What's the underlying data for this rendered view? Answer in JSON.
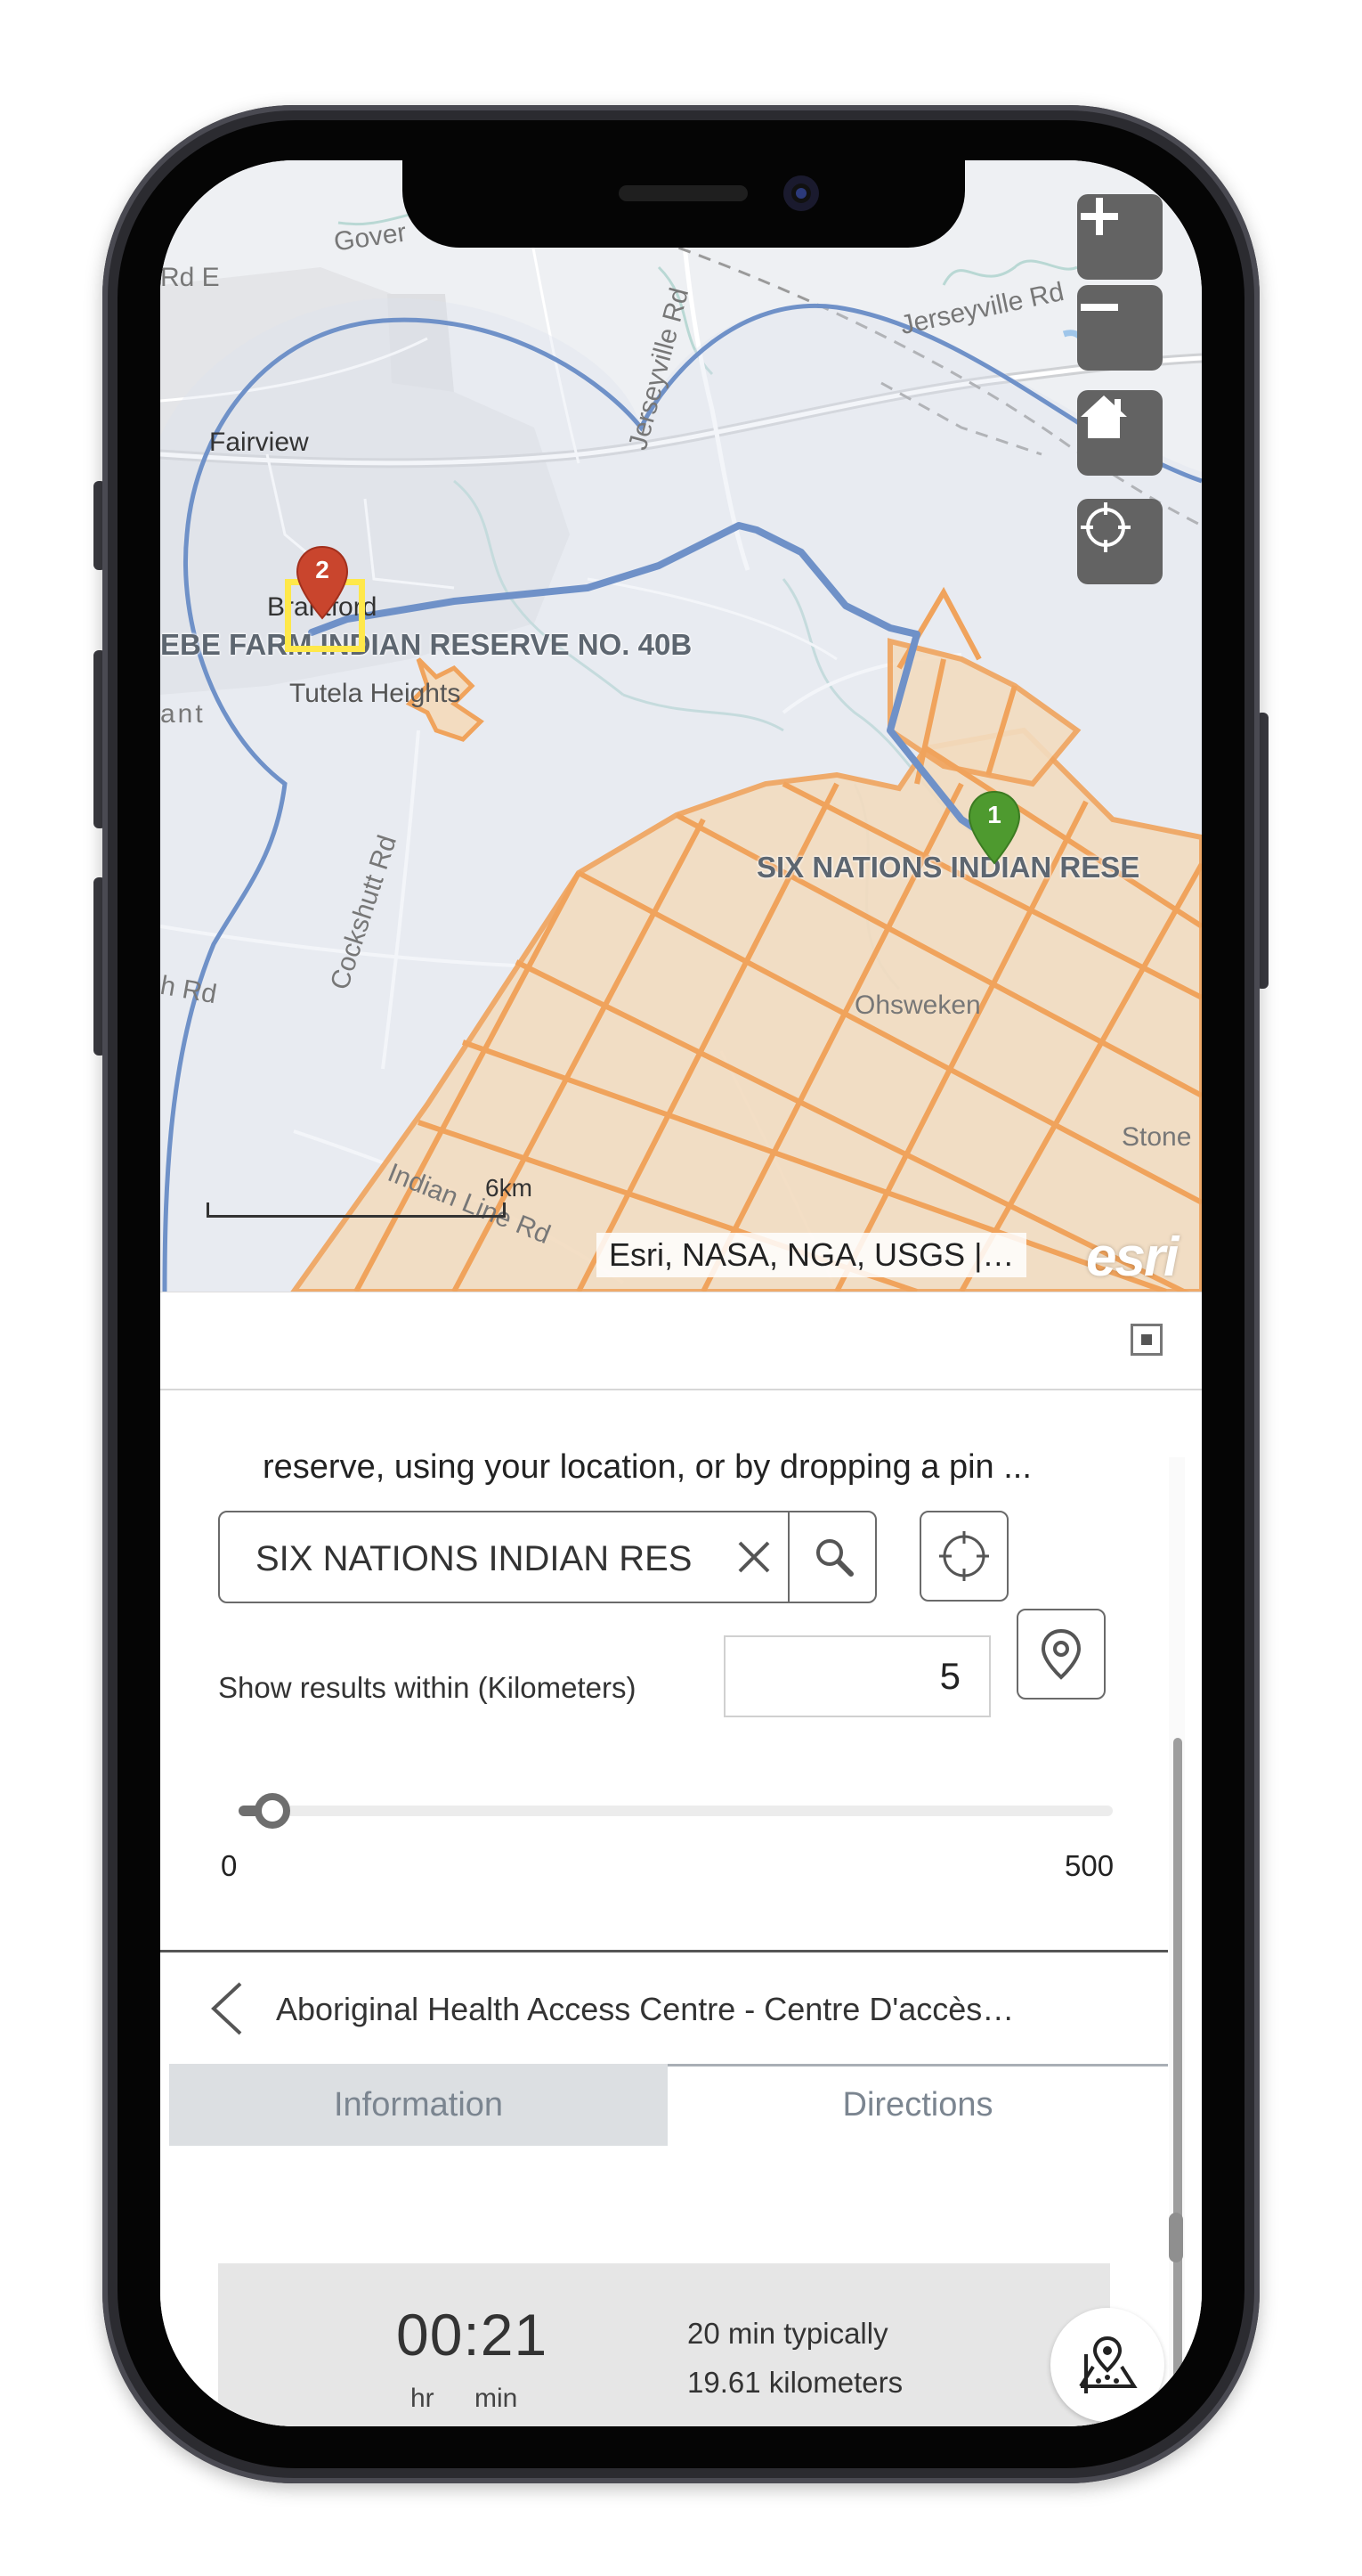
{
  "map": {
    "labels": {
      "fairview": "Fairview",
      "brantford": "Brantford",
      "tutela_heights": "Tutela Heights",
      "ohsweken": "Ohsweken",
      "stone": "Stone",
      "ant": "ant",
      "gover": "Gover",
      "rd_e": "Rd E",
      "jerseyville_rd_top": "Jerseyville Rd",
      "jerseyville_rd": "Jerseyville Rd",
      "cockshutt_rd": "Cockshutt Rd",
      "h_rd": "h Rd",
      "indian_line_rd": "Indian Line Rd",
      "reserve_40b": "EBE FARM INDIAN RESERVE NO. 40B",
      "six_nations": "SIX NATIONS INDIAN RESE"
    },
    "markers": {
      "origin": "1",
      "destination": "2"
    },
    "controls": {
      "zoom_in_icon": "plus-icon",
      "zoom_out_icon": "minus-icon",
      "home_icon": "home-icon",
      "locate_icon": "crosshair-icon"
    },
    "scale_label": "6km",
    "attribution": "Esri, NASA, NGA, USGS |…",
    "logo": "esri",
    "colors": {
      "route": "#6f91c8",
      "buffer": "#6f91c8",
      "reserve_fill": "#f3dcc0",
      "reserve_stroke": "#f0a35c",
      "marker_origin": "#4e9a2f",
      "marker_destination": "#c9452d",
      "highlight": "#ffe84a"
    }
  },
  "panel": {
    "instructions": "reserve, using your location, or by dropping a pin ...",
    "search": {
      "value": "SIX NATIONS INDIAN RESERVE",
      "clear_icon": "close-icon",
      "search_icon": "search-icon"
    },
    "locate_icon": "crosshair-icon",
    "drop_pin_icon": "map-pin-icon",
    "radius_label": "Show results within (Kilometers)",
    "radius_value": "5",
    "slider": {
      "min": "0",
      "max": "500",
      "value": 5
    },
    "result_title": "Aboriginal Health Access Centre - Centre D'accès…",
    "tabs": {
      "information": "Information",
      "directions": "Directions"
    },
    "directions": {
      "duration": "00:21",
      "unit_hr": "hr",
      "unit_min": "min",
      "typical": "20 min typically",
      "distance": "19.61 kilometers"
    }
  }
}
